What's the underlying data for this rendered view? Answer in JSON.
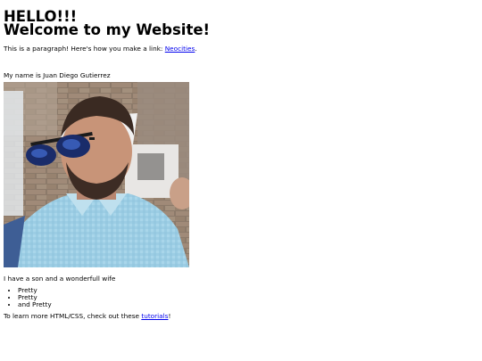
{
  "header": {
    "line1": "HELLO!!!",
    "line2": "Welcome to my Website!"
  },
  "intro": {
    "text": "This is a paragraph! Here's how you make a link: ",
    "link_label": "Neocities",
    "end": "."
  },
  "name_line": "My name is Juan Diego Gutierrez",
  "photo": {
    "icon": "portrait-photo"
  },
  "family_line": "I have a son and a wonderfull wife",
  "list": [
    "Pretty",
    "Pretty",
    "and Pretty"
  ],
  "outro": {
    "text": "To learn more HTML/CSS, check out these ",
    "link_label": "tutorials",
    "end": "!"
  },
  "colors": {
    "link": "#0000ee",
    "text": "#000000",
    "background": "#ffffff"
  }
}
